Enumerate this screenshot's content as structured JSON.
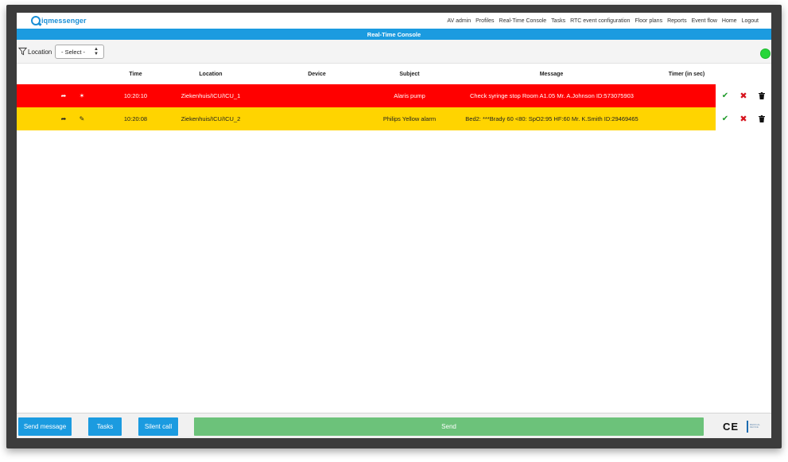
{
  "app": {
    "logo_text": "iqmessenger",
    "page_title": "Real-Time Console"
  },
  "nav": {
    "items": [
      "AV admin",
      "Profiles",
      "Real-Time Console",
      "Tasks",
      "RTC event configuration",
      "Floor plans",
      "Reports",
      "Event flow",
      "Home",
      "Logout"
    ]
  },
  "filter": {
    "label": "Location",
    "select_value": "- Select -"
  },
  "status": {
    "color": "#27d63a"
  },
  "table": {
    "headers": [
      "Time",
      "Location",
      "Device",
      "Subject",
      "Message",
      "Timer (in sec)"
    ],
    "rows": [
      {
        "severity": "red",
        "time": "10:20:10",
        "location": "Ziekenhuis/ICU/ICU_1",
        "device": "",
        "subject": "Alaris pump",
        "message": "Check syringe stop Room A1.05 Mr. A.Johnson ID:573075903",
        "timer": ""
      },
      {
        "severity": "yellow",
        "time": "10:20:08",
        "location": "Ziekenhuis/ICU/ICU_2",
        "device": "",
        "subject": "Philips Yellow alarm",
        "message": "Bed2: ***Brady 60 <80: SpO2:95 HF:60 Mr. K.Smith ID:29469465",
        "timer": ""
      }
    ]
  },
  "colors": {
    "accent": "#1b9be0",
    "alarm_red": "#ff0000",
    "alarm_yellow": "#ffd400",
    "send_green": "#6cc27a",
    "ok_green": "#1f9a2a",
    "reject_red": "#d6121c"
  },
  "bottom": {
    "send_message": "Send message",
    "tasks": "Tasks",
    "silent_call": "Silent call",
    "send": "Send",
    "ce_mark": "CE",
    "medical_device": "MEDICAL DEVICE"
  }
}
